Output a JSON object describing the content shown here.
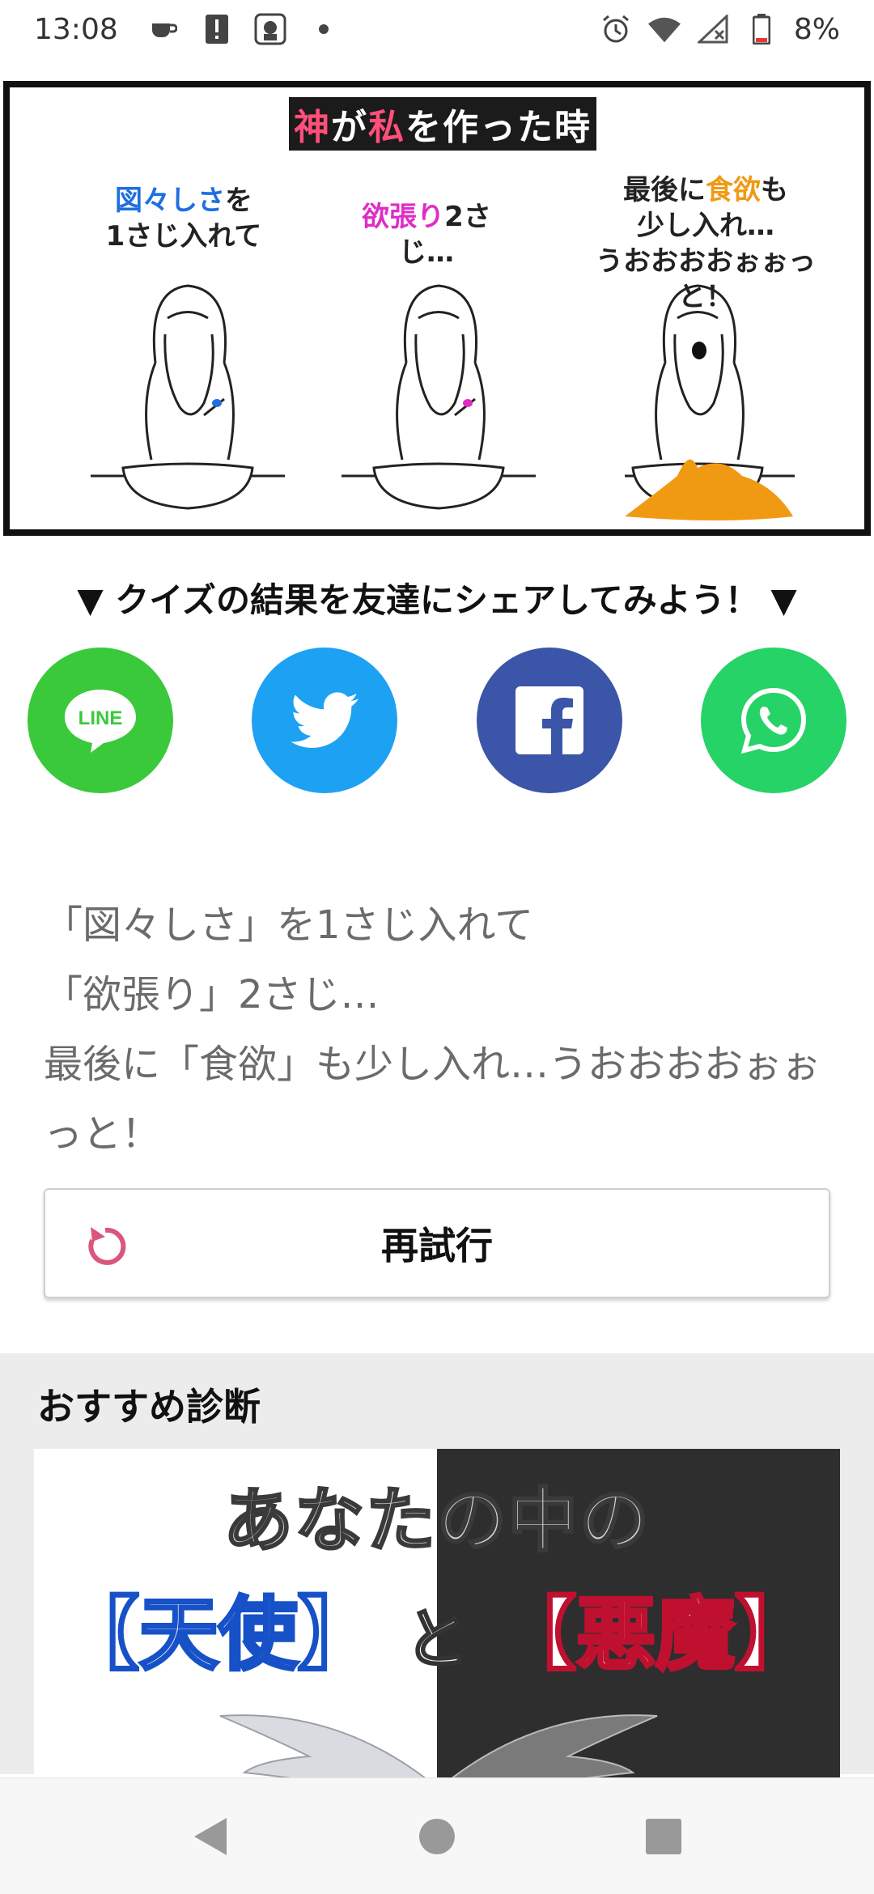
{
  "status_bar": {
    "time": "13:08",
    "battery": "8%",
    "icons_left": [
      "cup-icon",
      "alert-icon",
      "app-icon",
      "dot-icon"
    ],
    "icons_right": [
      "alarm-icon",
      "wifi-icon",
      "signal-icon",
      "battery-icon"
    ]
  },
  "hero": {
    "title_part1": "神",
    "title_part2": "が",
    "title_part3": "私",
    "title_part4": "を作った時",
    "panels": [
      {
        "cap_highlight": "図々しさ",
        "cap_rest": "を",
        "cap_line2": "1さじ入れて",
        "accent": "#1e6fe0"
      },
      {
        "cap_highlight": "欲張り",
        "cap_rest": "2さじ…",
        "accent": "#e02cc6"
      },
      {
        "cap_pre": "最後に",
        "cap_highlight": "食欲",
        "cap_rest": "も",
        "cap_line2": "少し入れ…",
        "cap_line3": "うおおおおぉぉっと！",
        "accent": "#f09a14"
      }
    ]
  },
  "share": {
    "heading": "▼ クイズの結果を友達にシェアしてみよう！ ▼",
    "buttons": [
      {
        "name": "LINE",
        "label": "LINE",
        "color": "#39c93a"
      },
      {
        "name": "Twitter",
        "color": "#1da1f2"
      },
      {
        "name": "Facebook",
        "color": "#3b55a8"
      },
      {
        "name": "WhatsApp",
        "color": "#25d366"
      }
    ]
  },
  "result": {
    "lines": [
      "「図々しさ」を1さじ入れて",
      "「欲張り」2さじ…",
      "最後に「食欲」も少し入れ…うおおおおぉぉ",
      "っと！"
    ]
  },
  "retry": {
    "label": "再試行"
  },
  "recommend": {
    "title": "おすすめ診断",
    "card_line1": "あなたの中の",
    "card_angel": "【天使】",
    "card_to": "と",
    "card_devil": "【悪魔】"
  }
}
